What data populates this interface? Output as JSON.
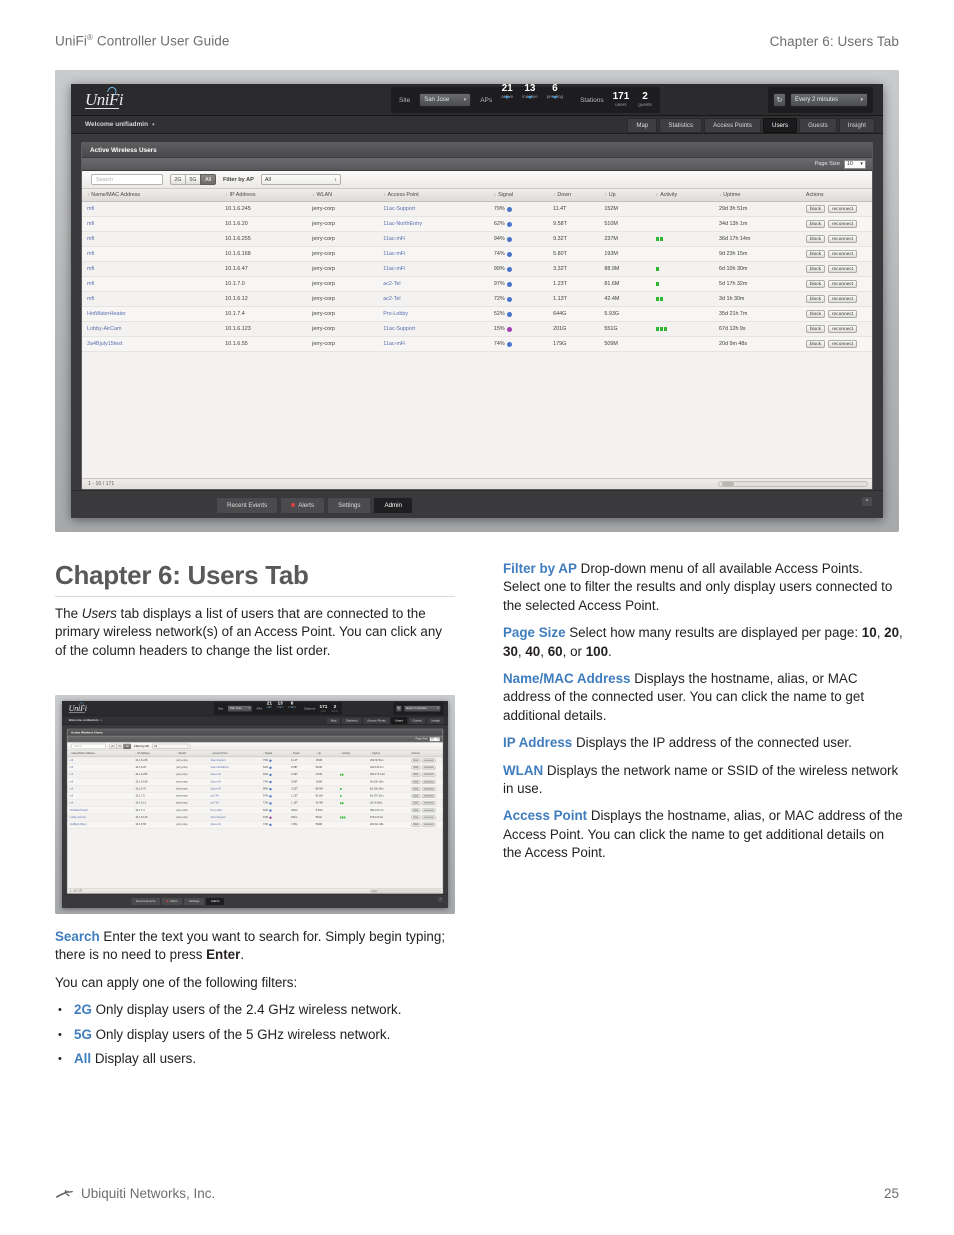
{
  "page_header": {
    "left": "UniFi",
    "left_sup": "®",
    "left_rest": " Controller User Guide",
    "right": "Chapter 6: Users Tab"
  },
  "app": {
    "logo": "UniFi",
    "topbar": {
      "site_label": "Site",
      "site_value": "San Jose",
      "aps_label": "APs",
      "aps_active": {
        "num": "21",
        "sub": "active"
      },
      "aps_inactive": {
        "num": "13",
        "sub": "inactive"
      },
      "aps_pending": {
        "num": "6",
        "sub": "pending"
      },
      "stations_label": "Stations",
      "stations_users": {
        "num": "171",
        "sub": "users"
      },
      "stations_guests": {
        "num": "2",
        "sub": "guests"
      },
      "refresh_icon": "refresh-icon",
      "refresh_value": "Every 2 minutes"
    },
    "welcome": "Welcome unifiadmin",
    "nav_tabs": [
      {
        "label": "Map",
        "active": false
      },
      {
        "label": "Statistics",
        "active": false
      },
      {
        "label": "Access Points",
        "active": false
      },
      {
        "label": "Users",
        "active": true
      },
      {
        "label": "Guests",
        "active": false
      },
      {
        "label": "Insight",
        "active": false
      }
    ],
    "panel_title": "Active Wireless Users",
    "page_size_label": "Page Size",
    "page_size_value": "10",
    "toolbar": {
      "search_placeholder": "Search",
      "segments": [
        {
          "label": "2G",
          "active": false
        },
        {
          "label": "5G",
          "active": false
        },
        {
          "label": "All",
          "active": true
        }
      ],
      "filter_label": "Filter by AP",
      "filter_value": "All"
    },
    "table": {
      "columns": [
        "Name/MAC Address",
        "IP Address",
        "WLAN",
        "Access Point",
        "Signal",
        "Down",
        "Up",
        "Activity",
        "Uptime",
        "Actions"
      ],
      "rows": [
        {
          "name": "mfi",
          "ip": "10.1.6.245",
          "wlan": "jerry-corp",
          "ap": "11ac-Support",
          "signal": "79%",
          "signal_color": "#4a74c9",
          "down": "11.4T",
          "up": "152M",
          "activity": 0,
          "uptime": "29d 3h 51m"
        },
        {
          "name": "mfi",
          "ip": "10.1.6.20",
          "wlan": "jerry-corp",
          "ap": "11ac-NorthEntry",
          "signal": "62%",
          "signal_color": "#4a74c9",
          "down": "9.58T",
          "up": "510M",
          "activity": 0,
          "uptime": "34d 13h 1m"
        },
        {
          "name": "mfi",
          "ip": "10.1.6.255",
          "wlan": "jerry-corp",
          "ap": "11ac-mFi",
          "signal": "94%",
          "signal_color": "#4a74c9",
          "down": "9.32T",
          "up": "237M",
          "activity": 2,
          "uptime": "36d 17h 14m"
        },
        {
          "name": "mfi",
          "ip": "10.1.6.168",
          "wlan": "jerry-corp",
          "ap": "11ac-mFi",
          "signal": "74%",
          "signal_color": "#4a74c9",
          "down": "5.80T",
          "up": "193M",
          "activity": 0,
          "uptime": "9d 23h 15m"
        },
        {
          "name": "mfi",
          "ip": "10.1.6.47",
          "wlan": "jerry-corp",
          "ap": "11ac-mFi",
          "signal": "99%",
          "signal_color": "#4a74c9",
          "down": "3.32T",
          "up": "88.9M",
          "activity": 1,
          "uptime": "6d 10h 30m"
        },
        {
          "name": "mfi",
          "ip": "10.1.7.0",
          "wlan": "jerry-corp",
          "ap": "ac2-Tel",
          "signal": "97%",
          "signal_color": "#4a74c9",
          "down": "1.23T",
          "up": "81.6M",
          "activity": 1,
          "uptime": "5d 17h 32m"
        },
        {
          "name": "mfi",
          "ip": "10.1.6.12",
          "wlan": "jerry-corp",
          "ap": "ac2-Tel",
          "signal": "72%",
          "signal_color": "#4a74c9",
          "down": "1.13T",
          "up": "42.4M",
          "activity": 2,
          "uptime": "3d 1h 30m"
        },
        {
          "name": "HotWaterHeater",
          "ip": "10.1.7.4",
          "wlan": "jerry-corp",
          "ap": "Pro-Lobby",
          "signal": "52%",
          "signal_color": "#4a74c9",
          "down": "644G",
          "up": "5.93G",
          "activity": 0,
          "uptime": "35d 21h 7m"
        },
        {
          "name": "Lobby-AirCam",
          "ip": "10.1.6.123",
          "wlan": "jerry-corp",
          "ap": "11ac-Support",
          "signal": "15%",
          "signal_color": "#a03fb0",
          "down": "201G",
          "up": "551G",
          "activity": 3,
          "uptime": "67d 12h 9s"
        },
        {
          "name": "3a4Bjuly15test",
          "ip": "10.1.6.55",
          "wlan": "jerry-corp",
          "ap": "11ac-mFi",
          "signal": "74%",
          "signal_color": "#4a74c9",
          "down": "179G",
          "up": "509M",
          "activity": 0,
          "uptime": "20d 9m 48s"
        }
      ],
      "action_block": "block",
      "action_reconnect": "reconnect",
      "pagination": "1 - 10 / 171"
    },
    "bottom_tabs": [
      {
        "label": "Recent Events",
        "active": false,
        "dot": false
      },
      {
        "label": "Alerts",
        "active": false,
        "dot": true
      },
      {
        "label": "Settings",
        "active": false,
        "dot": false
      },
      {
        "label": "Admin",
        "active": true,
        "dot": false
      }
    ],
    "collapse_icon": "chevron-up-icon"
  },
  "content": {
    "chapter_title": "Chapter 6: Users Tab",
    "intro_1": "The ",
    "intro_italic": "Users",
    "intro_2": " tab displays a list of users that are connected to the primary wireless network(s) of an Access Point. You can click any of the column headers to change the list order.",
    "search_kw": "Search",
    "search_text_1": "  Enter the text you want to search for. Simply begin typing; there is no need to press ",
    "search_bold": "Enter",
    "search_text_2": ".",
    "filters_intro": "You can apply one of the following filters:",
    "filters": [
      {
        "kw": "2G",
        "text": "  Only display users of the 2.4 GHz wireless network."
      },
      {
        "kw": "5G",
        "text": "  Only display users of the 5 GHz wireless network."
      },
      {
        "kw": "All",
        "text": "  Display all users."
      }
    ],
    "right": {
      "filter_by_ap_kw": "Filter by AP",
      "filter_by_ap_text": "  Drop-down menu of all available Access Points. Select one to filter the results and only display users connected to the selected Access Point.",
      "page_size_kw": "Page Size",
      "page_size_text_1": "  Select how many results are displayed per page: ",
      "page_size_opts": [
        "10",
        "20",
        "30",
        "40",
        "60",
        "100"
      ],
      "page_size_text_2": ", or ",
      "page_size_text_3": ".",
      "name_mac_kw": "Name/MAC Address",
      "name_mac_text": "  Displays the hostname, alias, or MAC address of the connected user. You can click the name to get additional details.",
      "ip_kw": "IP Address",
      "ip_text": "  Displays the IP address of the connected user.",
      "wlan_kw": "WLAN",
      "wlan_text": "  Displays the network name or SSID of the wireless network in use.",
      "ap_kw": "Access Point",
      "ap_text": "  Displays the hostname, alias, or MAC address of the Access Point. You can click the name to get additional details on the Access Point."
    }
  },
  "footer": {
    "company": "Ubiquiti Networks, Inc.",
    "page_number": "25",
    "logo_icon": "ubiquiti-logo-icon"
  },
  "colors": {
    "accent_blue": "#3f7dbf",
    "heading_gray": "#58595b",
    "activity_green": "#2fb62f",
    "signal_blue": "#4a74c9",
    "signal_purple": "#a03fb0",
    "alert_red": "#d9423c"
  }
}
